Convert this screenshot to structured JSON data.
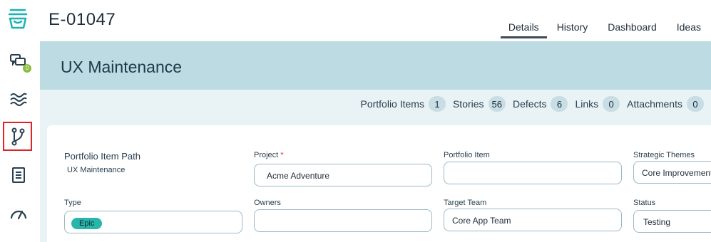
{
  "header": {
    "item_id": "E-01047",
    "tabs": [
      {
        "label": "Details",
        "active": true
      },
      {
        "label": "History",
        "active": false
      },
      {
        "label": "Dashboard",
        "active": false
      },
      {
        "label": "Ideas",
        "active": false
      }
    ]
  },
  "rail": {
    "items": [
      {
        "icon": "inbox-tray-icon",
        "selected": false
      },
      {
        "icon": "conversations-icon",
        "badge": "0",
        "selected": false
      },
      {
        "icon": "waves-icon",
        "selected": false
      },
      {
        "icon": "branch-icon",
        "selected": true
      },
      {
        "icon": "document-icon",
        "selected": false
      },
      {
        "icon": "gauge-icon",
        "selected": false
      }
    ]
  },
  "banner": {
    "title": "UX Maintenance"
  },
  "counts": [
    {
      "label": "Portfolio Items",
      "value": "1"
    },
    {
      "label": "Stories",
      "value": "56"
    },
    {
      "label": "Defects",
      "value": "6"
    },
    {
      "label": "Links",
      "value": "0"
    },
    {
      "label": "Attachments",
      "value": "0"
    }
  ],
  "fields": {
    "portfolio_item_path": {
      "label": "Portfolio Item Path",
      "value": "UX Maintenance"
    },
    "project": {
      "label": "Project",
      "required_mark": "*",
      "value": "Acme Adventure"
    },
    "portfolio_item": {
      "label": "Portfolio Item",
      "value": ""
    },
    "strategic_themes": {
      "label": "Strategic Themes",
      "value": "Core Improvement"
    },
    "type": {
      "label": "Type",
      "value": "Epic"
    },
    "owners": {
      "label": "Owners",
      "value": ""
    },
    "target_team": {
      "label": "Target Team",
      "value": "Core App Team"
    },
    "status": {
      "label": "Status",
      "value": "Testing"
    }
  },
  "colors": {
    "banner": "#bcdbe3",
    "strip": "#e9f3f6",
    "accent": "#28b5aa",
    "selected_outline": "#e02424"
  }
}
